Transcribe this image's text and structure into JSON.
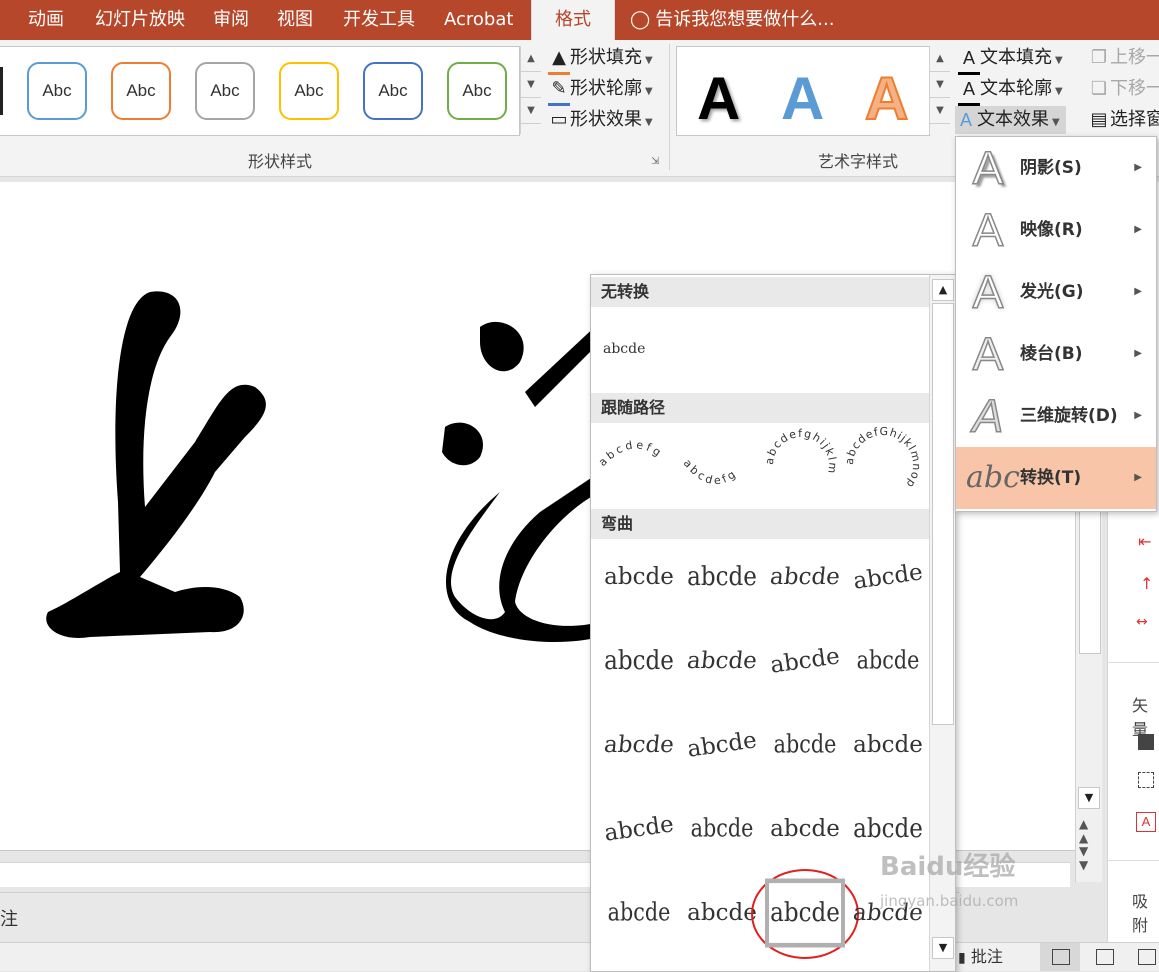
{
  "tabs": [
    "动画",
    "幻灯片放映",
    "审阅",
    "视图",
    "开发工具",
    "Acrobat",
    "格式"
  ],
  "active_tab": "格式",
  "tell_me": "告诉我您想要做什么...",
  "shape_styles": {
    "group_label": "形状样式",
    "swatch_text": "Abc",
    "swatch_colors": [
      "#5b9bd5",
      "#ed7d31",
      "#a5a5a5",
      "#ffc000",
      "#4472c4",
      "#70ad47"
    ],
    "fill": "形状填充",
    "outline": "形状轮廓",
    "effects": "形状效果"
  },
  "wordart_styles": {
    "group_label": "艺术字样式",
    "sample": "A",
    "text_fill": "文本填充",
    "text_outline": "文本轮廓",
    "text_effects": "文本效果"
  },
  "arrange": {
    "bring_forward": "上移一",
    "send_backward": "下移一",
    "selection_pane": "选择窗"
  },
  "effects_menu": [
    {
      "label": "阴影(S)",
      "icon": "shadow-icon"
    },
    {
      "label": "映像(R)",
      "icon": "reflection-icon"
    },
    {
      "label": "发光(G)",
      "icon": "glow-icon"
    },
    {
      "label": "棱台(B)",
      "icon": "bevel-icon"
    },
    {
      "label": "三维旋转(D)",
      "icon": "3d-rotation-icon"
    },
    {
      "label": "转换(T)",
      "icon": "transform-icon",
      "highlighted": true
    }
  ],
  "transform_gallery": {
    "no_transform": {
      "heading": "无转换",
      "sample": "abcde"
    },
    "follow_path": {
      "heading": "跟随路径",
      "samples": [
        "abcdefg",
        "abcdefg",
        "abcdefghijklm",
        "abcdefGhijklmnop"
      ]
    },
    "warp": {
      "heading": "弯曲",
      "sample": "abcde",
      "rows": 5,
      "cols": 4,
      "selected_row": 4,
      "selected_col": 2
    }
  },
  "slide_text": "上海",
  "notes_label": "注",
  "status": {
    "comments": "批注"
  },
  "right_pane": {
    "vector": "矢量",
    "absorb": "吸附"
  },
  "watermark": {
    "brand": "Baidu经验",
    "url": "jingyan.baidu.com"
  }
}
